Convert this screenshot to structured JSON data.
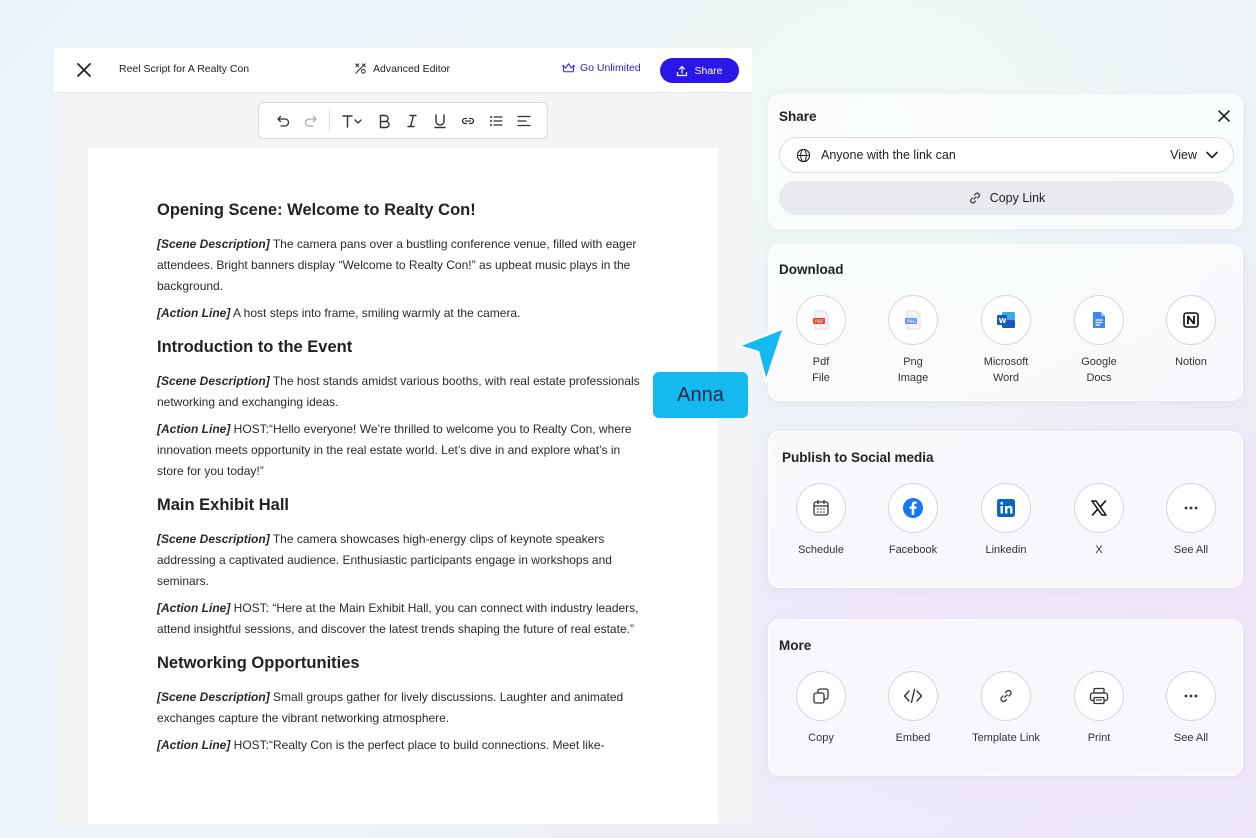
{
  "editor": {
    "doc_title": "Reel Script for A Realty Con",
    "advanced_editor": "Advanced Editor",
    "go_unlimited": "Go Unlimited",
    "share_label": "Share"
  },
  "toolbar": {
    "icons": [
      "undo-icon",
      "redo-icon",
      "text-style-icon",
      "bold-icon",
      "italic-icon",
      "underline-icon",
      "link-icon",
      "bullet-list-icon",
      "align-left-icon"
    ]
  },
  "document": {
    "sections": [
      {
        "heading": "Opening Scene: Welcome to Realty Con!",
        "paragraphs": [
          {
            "tag": "[Scene Description]",
            "text": " The camera pans over a bustling conference venue, filled with eager attendees. Bright banners display “Welcome to Realty Con!” as upbeat music plays in the background."
          },
          {
            "tag": "[Action Line]",
            "text": " A host steps into frame, smiling warmly at the camera."
          }
        ]
      },
      {
        "heading": "Introduction to the Event",
        "paragraphs": [
          {
            "tag": "[Scene Description]",
            "text": " The host stands amidst various booths, with real estate professionals networking and exchanging ideas."
          },
          {
            "tag": "[Action Line]",
            "text": " HOST:“Hello everyone! We’re thrilled to welcome you to Realty Con, where innovation meets opportunity in the real estate world. Let’s dive in and explore what’s in store for you today!”"
          }
        ]
      },
      {
        "heading": "Main Exhibit Hall",
        "paragraphs": [
          {
            "tag": "[Scene Description]",
            "text": " The camera showcases high-energy clips of keynote speakers addressing a captivated audience. Enthusiastic participants engage in workshops and seminars."
          },
          {
            "tag": "[Action Line]",
            "text": " HOST: “Here at the Main Exhibit Hall, you can connect with industry leaders, attend insightful sessions, and discover the latest trends shaping the future of real estate.”"
          }
        ]
      },
      {
        "heading": "Networking Opportunities",
        "paragraphs": [
          {
            "tag": "[Scene Description]",
            "text": " Small groups gather for lively discussions. Laughter and animated exchanges capture the vibrant networking atmosphere."
          },
          {
            "tag": "[Action Line]",
            "text": " HOST:“Realty Con is the perfect place to build connections. Meet like-"
          }
        ]
      }
    ]
  },
  "share_panel": {
    "title": "Share",
    "access_label": "Anyone with the link can",
    "access_value": "View",
    "copy_link": "Copy Link"
  },
  "download_panel": {
    "title": "Download",
    "items": [
      {
        "line1": "Pdf",
        "line2": "File"
      },
      {
        "line1": "Png",
        "line2": "Image"
      },
      {
        "line1": "Microsoft",
        "line2": "Word"
      },
      {
        "line1": "Google",
        "line2": "Docs"
      },
      {
        "line1": "Notion",
        "line2": ""
      }
    ]
  },
  "social_panel": {
    "title": "Publish to Social media",
    "items": [
      "Schedule",
      "Facebook",
      "Linkedin",
      "X",
      "See All"
    ]
  },
  "more_panel": {
    "title": "More",
    "items": [
      "Copy",
      "Embed",
      "Template Link",
      "Print",
      "See All"
    ]
  },
  "cursor": {
    "user": "Anna",
    "color": "#16b8f0"
  },
  "colors": {
    "primary": "#2b16e8",
    "facebook": "#1877f2",
    "linkedin": "#0a66c2",
    "word": "#185abd",
    "docs": "#4285f4",
    "pdf": "#e8453c"
  }
}
